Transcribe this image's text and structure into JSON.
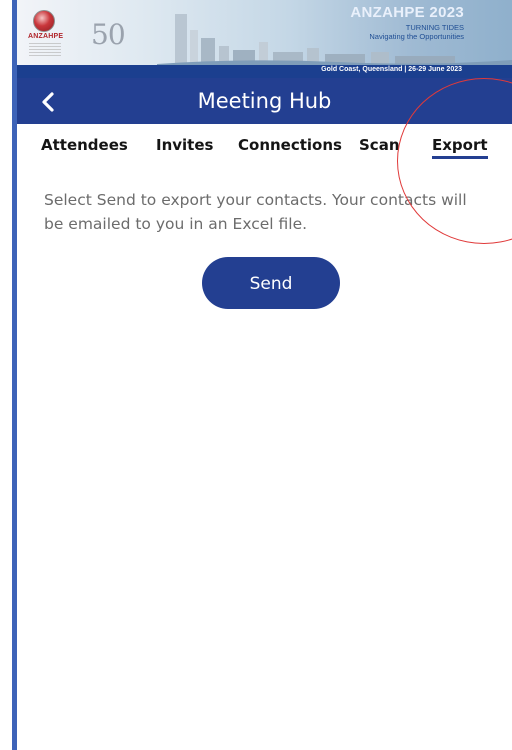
{
  "banner": {
    "logo_text": "ANZAHPE",
    "anniversary": "50",
    "conference_name": "ANZAHPE 2023",
    "tagline_line1": "TURNING TIDES",
    "tagline_line2": "Navigating the Opportunities",
    "location_dates": "Gold Coast, Queensland | 26-29 June 2023"
  },
  "header": {
    "title": "Meeting Hub",
    "back_icon": "chevron-left-icon"
  },
  "tabs": [
    {
      "label": "Attendees",
      "active": false
    },
    {
      "label": "Invites",
      "active": false
    },
    {
      "label": "Connections",
      "active": false
    },
    {
      "label": "Scan",
      "active": false
    },
    {
      "label": "Export",
      "active": true
    }
  ],
  "export": {
    "message": "Select Send to export your contacts. Your contacts will be emailed to you in an Excel file.",
    "send_label": "Send"
  },
  "colors": {
    "primary": "#233f91",
    "annotation": "#e03a3a"
  }
}
